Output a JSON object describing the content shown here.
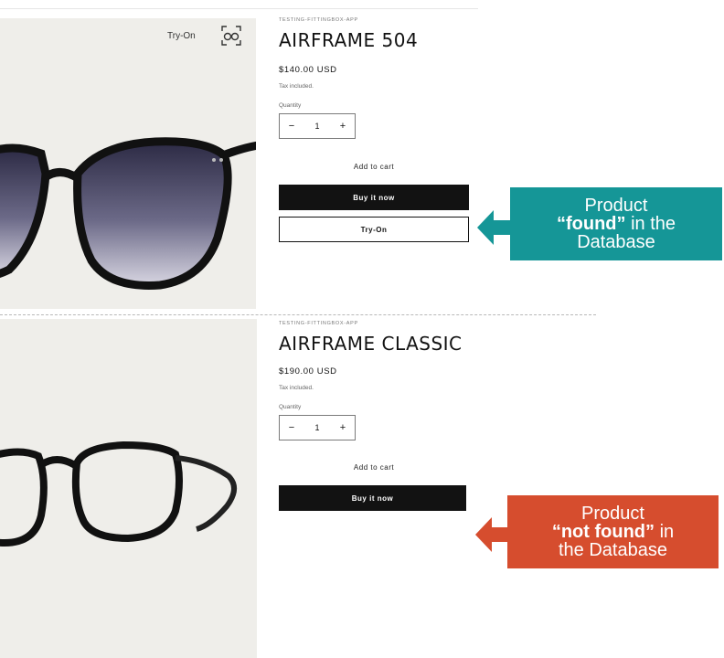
{
  "colors": {
    "found_callout": "#159697",
    "not_found_callout": "#d64d2e",
    "buy_button": "#121212",
    "media_bg": "#efeeea"
  },
  "product1": {
    "vendor": "TESTING-FITTINGBOX-APP",
    "title": "AIRFRAME 504",
    "price": "$140.00 USD",
    "tax_note": "Tax included.",
    "quantity_label": "Quantity",
    "quantity_minus": "−",
    "quantity_value": "1",
    "quantity_plus": "+",
    "add_to_cart": "Add to cart",
    "buy_now": "Buy it now",
    "try_on_button": "Try-On",
    "media_try_on_label": "Try-On",
    "media_icon": "glasses-scan-icon"
  },
  "product2": {
    "vendor": "TESTING-FITTINGBOX-APP",
    "title": "AIRFRAME CLASSIC",
    "price": "$190.00 USD",
    "tax_note": "Tax included.",
    "quantity_label": "Quantity",
    "quantity_minus": "−",
    "quantity_value": "1",
    "quantity_plus": "+",
    "add_to_cart": "Add to cart",
    "buy_now": "Buy it now"
  },
  "callout_found": {
    "line1": "Product",
    "line2_bold": "“found”",
    "line2_rest": " in the",
    "line3": "Database"
  },
  "callout_not_found": {
    "line1": "Product",
    "line2_bold": "“not found”",
    "line2_rest": " in",
    "line3": "the Database"
  }
}
